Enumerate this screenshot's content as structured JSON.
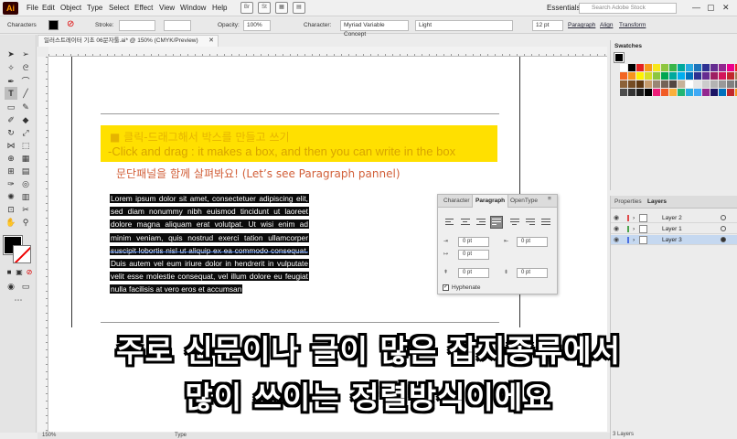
{
  "app": {
    "logo": "Ai",
    "title": "일러스트레이터 기초 06문자툴.ai* @ 150% (CMYK/Preview)"
  },
  "menu": {
    "items": [
      "File",
      "Edit",
      "Object",
      "Type",
      "Select",
      "Effect",
      "View",
      "Window",
      "Help"
    ],
    "workspace": "Essentials",
    "search_placeholder": "Search Adobe Stock",
    "bridge": "Br",
    "stock": "St"
  },
  "control_bar": {
    "label": "Characters",
    "stroke": "Stroke:",
    "opacity_label": "Opacity:",
    "opacity": "100%",
    "character": "Character:",
    "font": "Myriad Variable Concept",
    "style": "Light",
    "size": "12 pt",
    "paragraph": "Paragraph",
    "align": "Align",
    "transform": "Transform"
  },
  "document": {
    "heading_kr": "■ 클릭-드래그해서 박스를 만들고 쓰기",
    "heading_en": "-Click and drag : it makes a box, and then you can write in the box",
    "subtitle": "문단패널을 함께 살펴봐요! (Let’s see Paragraph pannel)",
    "lorem": "Lorem ipsum dolor sit amet, consectetuer adipiscing elit, sed diam nonummy nibh euismod tincidunt ut laoreet dolore magna aliquam erat volutpat. Ut wisi enim ad minim veniam, quis nostrud exerci tation ullamcorper suscipit lobortis nisl ut aliquip ex ea commodo consequat. Duis autem vel eum iriure dolor in hendrerit in vulputate velit esse molestie consequat, vel illum dolore eu feugiat nulla facilisis at vero eros et accumsan"
  },
  "paragraph_panel": {
    "tabs": [
      "Character",
      "Paragraph",
      "OpenType"
    ],
    "active_alignment": "justify-last-left",
    "fields": {
      "left_indent": "0 pt",
      "right_indent": "0 pt",
      "first_line_indent": "0 pt",
      "space_before": "0 pt",
      "space_after": "0 pt"
    },
    "hyphenate_label": "Hyphenate",
    "hyphenate_checked": true
  },
  "swatches": {
    "title": "Swatches"
  },
  "layers": {
    "tabs": [
      "Properties",
      "Layers"
    ],
    "items": [
      {
        "name": "Layer 2",
        "color": "#e04a4a",
        "selected": false
      },
      {
        "name": "Layer 1",
        "color": "#4aa24a",
        "selected": false
      },
      {
        "name": "Layer 3",
        "color": "#4a6ee0",
        "selected": true
      }
    ],
    "count": "3 Layers"
  },
  "status": {
    "zoom": "150%",
    "tool": "Type"
  },
  "caption": {
    "line1": "주로 신문이나 글이 많은 잡지종류에서",
    "line2": "많이 쓰이는 정렬방식이에요"
  }
}
